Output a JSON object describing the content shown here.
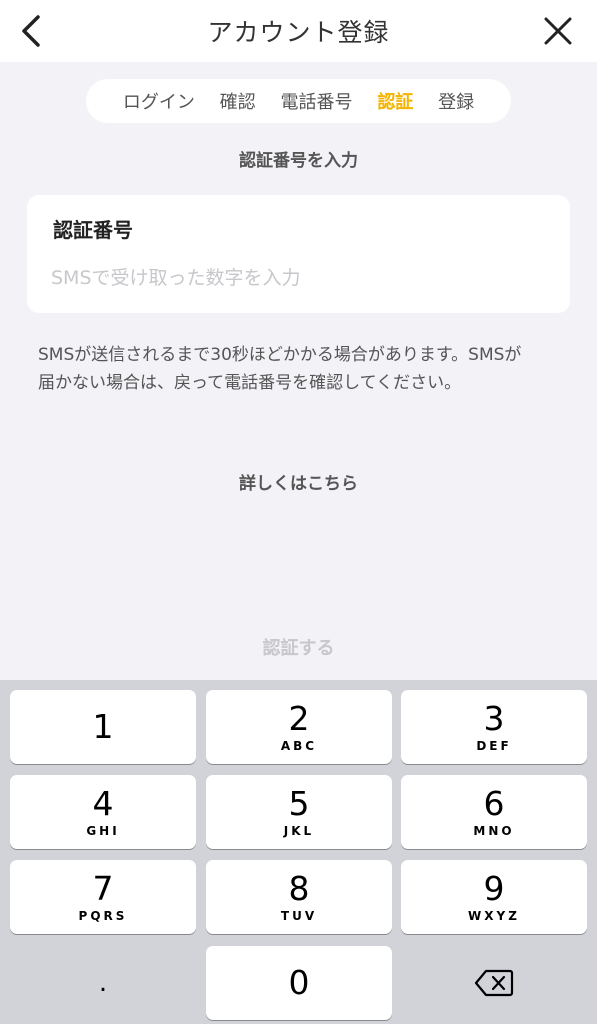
{
  "header": {
    "title": "アカウント登録",
    "back_icon": "chevron-left-icon",
    "close_icon": "close-icon"
  },
  "steps": {
    "items": [
      "ログイン",
      "確認",
      "電話番号",
      "認証",
      "登録"
    ],
    "active_index": 3,
    "active_color": "#f5b400"
  },
  "section_label": "認証番号を入力",
  "form": {
    "field_label": "認証番号",
    "field_value": "",
    "field_placeholder": "SMSで受け取った数字を入力"
  },
  "notice": "SMSが送信されるまで30秒ほどかかる場合があります。SMSが届かない場合は、戻って電話番号を確認してください。",
  "details_link": "詳しくはこちら",
  "submit_label": "認証する",
  "keyboard": {
    "keys": [
      {
        "digit": "1",
        "letters": ""
      },
      {
        "digit": "2",
        "letters": "ABC"
      },
      {
        "digit": "3",
        "letters": "DEF"
      },
      {
        "digit": "4",
        "letters": "GHI"
      },
      {
        "digit": "5",
        "letters": "JKL"
      },
      {
        "digit": "6",
        "letters": "MNO"
      },
      {
        "digit": "7",
        "letters": "PQRS"
      },
      {
        "digit": "8",
        "letters": "TUV"
      },
      {
        "digit": "9",
        "letters": "WXYZ"
      }
    ],
    "dot": ".",
    "zero": "0",
    "delete_icon": "backspace-icon"
  }
}
